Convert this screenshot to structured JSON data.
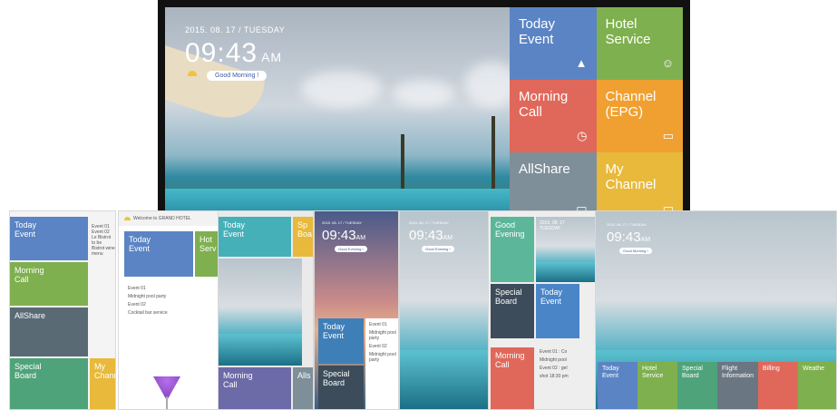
{
  "tv": {
    "date": "2015. 08. 17 / TUESDAY",
    "time": "09:43",
    "ampm": "AM",
    "greeting": "Good Morning !",
    "tiles": [
      {
        "label": "Today\nEvent",
        "color": "#5b84c4",
        "icon": "party-hat-icon",
        "glyph": "▲"
      },
      {
        "label": "Hotel\nService",
        "color": "#7fb04f",
        "icon": "concierge-icon",
        "glyph": "☺"
      },
      {
        "label": "Morning\nCall",
        "color": "#e0685a",
        "icon": "alarm-clock-icon",
        "glyph": "◷"
      },
      {
        "label": "Channel\n(EPG)",
        "color": "#f0a030",
        "icon": "tv-guide-icon",
        "glyph": "▭"
      },
      {
        "label": "AllShare",
        "color": "#7e8f99",
        "icon": "share-icon",
        "glyph": "▭"
      },
      {
        "label": "My\nChannel",
        "color": "#e8b93b",
        "icon": "channel-icon",
        "glyph": "▭"
      }
    ]
  },
  "panels": {
    "p1": {
      "tiles": [
        {
          "label": "Today\nEvent",
          "color": "#5b84c4"
        },
        {
          "label": "Morning\nCall",
          "color": "#7fb04f"
        },
        {
          "label": "AllShare",
          "color": "#5a6a74"
        },
        {
          "label": "Special\nBoard",
          "color": "#4fa37a"
        }
      ],
      "side_label": "My\nChann",
      "text_lines": [
        "Event 01",
        "Event 02",
        "Le Bistrot to be",
        "Bistrot wine",
        "menu"
      ]
    },
    "p2": {
      "welcome": "Welcome to GRAND HOTEL",
      "tile": "Today\nEvent",
      "tile_color": "#5b84c4",
      "events": [
        "Event 01",
        "Midnight pool party",
        "Event 02",
        "Cocktail bar service"
      ],
      "side": "Hot\nServ"
    },
    "p3": {
      "tile1": "Today\nEvent",
      "tile1_color": "#45b0b8",
      "tile2": "Morning\nCall",
      "tile2_color": "#6d6aa8",
      "side1": "Sp\nBoa",
      "side2": "Alls"
    },
    "p4": {
      "date": "2015. 08. 17 / TUESDAY",
      "time": "09:43",
      "ampm": "AM",
      "greeting": "Good Evening !",
      "tile1": "Today\nEvent",
      "tile1_color": "#3f7fb8",
      "tile2": "Special\nBoard",
      "tile2_color": "#3c4c5a",
      "events": [
        "Event 01",
        "Midnight pool party",
        "Event 02",
        "Midnight pool party"
      ]
    },
    "p5": {
      "date": "2015. 08. 17 / TUESDAY",
      "time": "09:43",
      "ampm": "AM",
      "greeting": "Good Evening !"
    },
    "p6": {
      "greet": "Good\nEvening",
      "greet_color": "#5cb79a",
      "date": "2015. 08. 17\nTUESDAY",
      "tile1": "Special\nBoard",
      "tile1_color": "#3c4c5a",
      "tile2": "Today\nEvent",
      "tile2_color": "#4a85c8",
      "tile3": "Morning\nCall",
      "tile3_color": "#e0685a",
      "events": [
        "Event 01 : Co",
        "Midnight pool",
        "Event 02 : gel",
        "shot 18:30 pm"
      ]
    },
    "p7": {
      "date": "2015. 08. 17 / TUESDAY",
      "time": "09:43",
      "ampm": "AM",
      "greeting": "Good Morning !",
      "bottom_tiles": [
        {
          "label": "Today\nEvent",
          "color": "#5b84c4"
        },
        {
          "label": "Hotel\nService",
          "color": "#7fb04f"
        },
        {
          "label": "Special\nBoard",
          "color": "#4fa37a"
        },
        {
          "label": "Flight\nInformation",
          "color": "#6a7682"
        },
        {
          "label": "Billing",
          "color": "#e0685a"
        },
        {
          "label": "Weathe",
          "color": "#7fb04f"
        }
      ]
    }
  }
}
